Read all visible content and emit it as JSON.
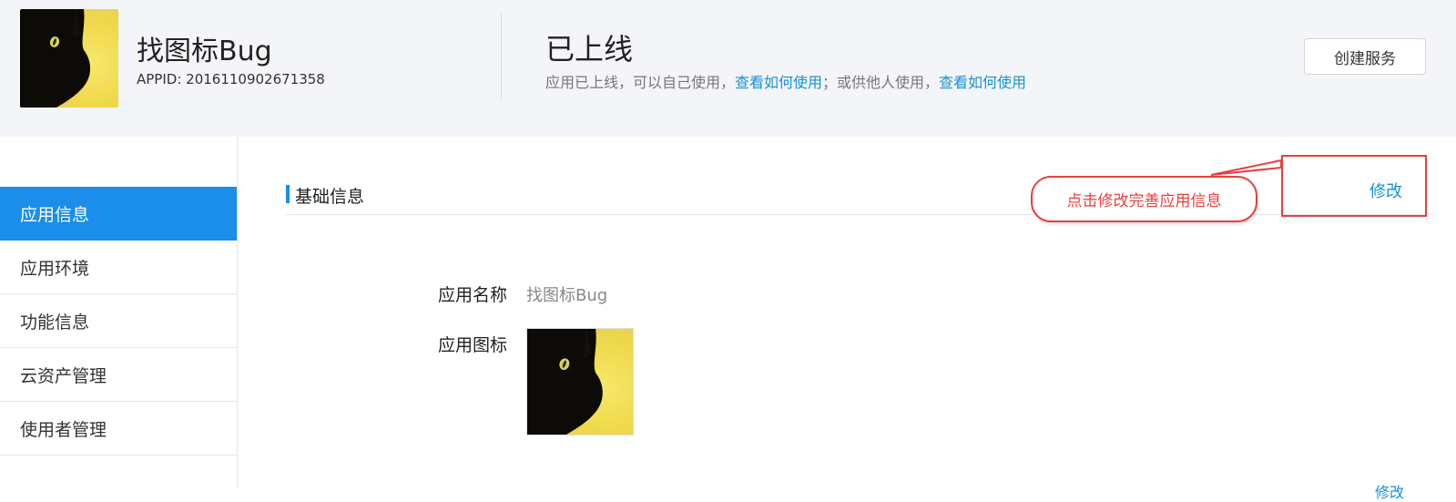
{
  "header": {
    "app_name": "找图标Bug",
    "appid": "APPID: 2016110902671358",
    "status_title": "已上线",
    "status_desc_1": "应用已上线，可以自己使用，",
    "status_link_1": "查看如何使用",
    "status_desc_2": "；或供他人使用，",
    "status_link_2": "查看如何使用",
    "create_button": "创建服务"
  },
  "sidebar": {
    "items": [
      {
        "label": "应用信息",
        "active": true
      },
      {
        "label": "应用环境",
        "active": false
      },
      {
        "label": "功能信息",
        "active": false
      },
      {
        "label": "云资产管理",
        "active": false
      },
      {
        "label": "使用者管理",
        "active": false
      }
    ]
  },
  "main": {
    "section_title": "基础信息",
    "edit_label": "修改",
    "annotation": "点击修改完善应用信息",
    "fields": {
      "name_label": "应用名称",
      "name_value": "找图标Bug",
      "icon_label": "应用图标"
    },
    "partial_link": "修改"
  },
  "colors": {
    "accent": "#1a8eea",
    "link": "#1890d7",
    "annotation_red": "#e4413e",
    "header_bg": "#f4f5f8"
  }
}
